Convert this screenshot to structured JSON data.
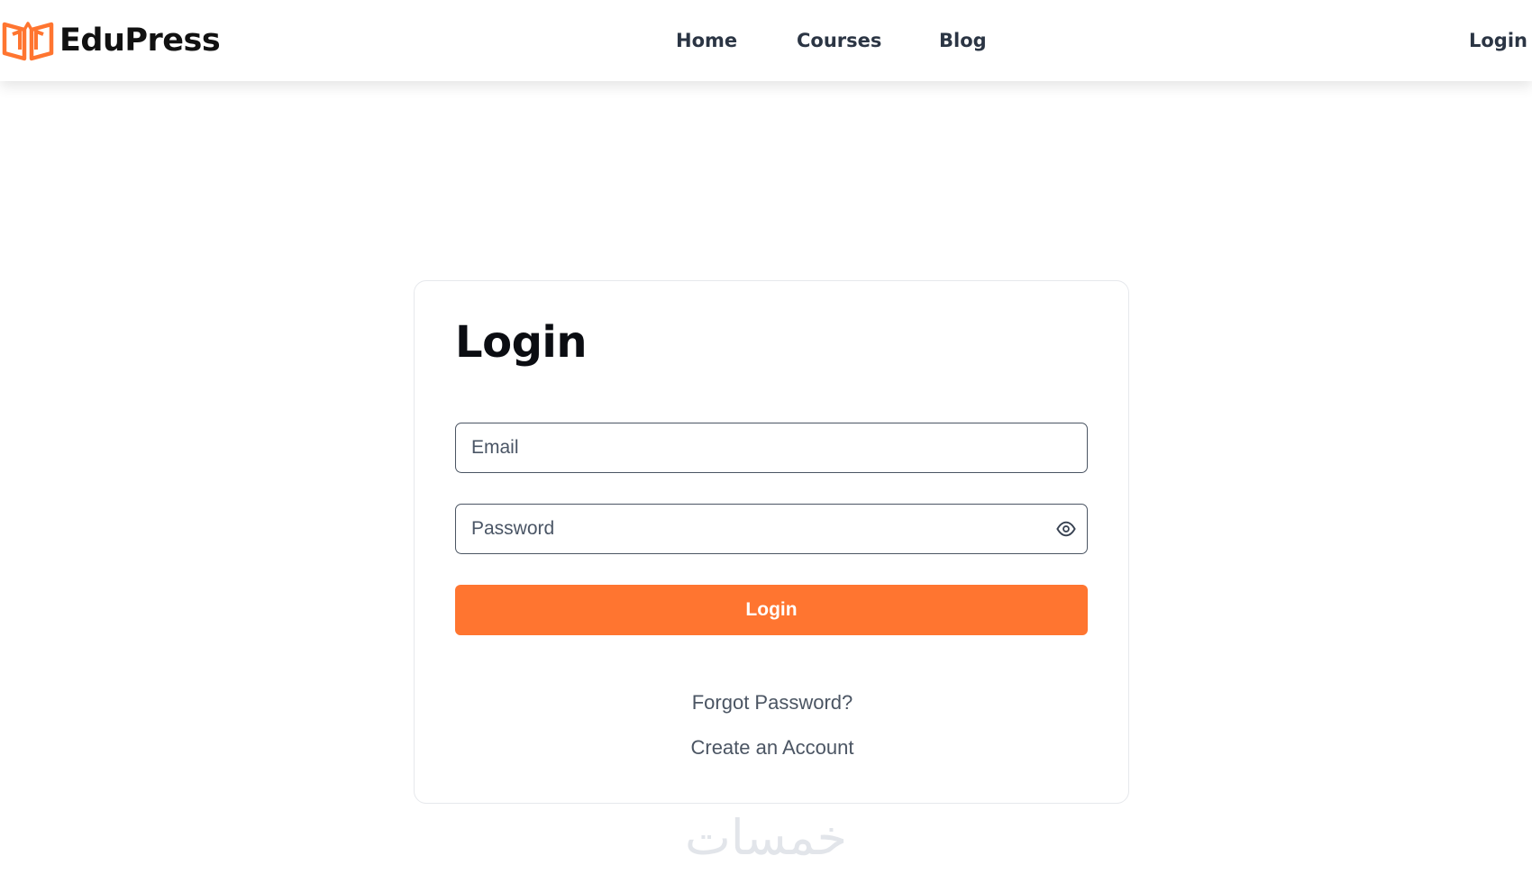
{
  "navbar": {
    "brand": "EduPress",
    "brand_icon": "open-book-icon",
    "accent_color": "#ff7530",
    "links": {
      "home": "Home",
      "courses": "Courses",
      "blog": "Blog",
      "login": "Login"
    }
  },
  "login_card": {
    "title": "Login",
    "email_placeholder": "Email",
    "password_placeholder": "Password",
    "password_toggle_icon": "eye-icon",
    "submit_label": "Login",
    "forgot_password": "Forgot Password?",
    "create_account": "Create an Account"
  },
  "watermark": "خمسات"
}
